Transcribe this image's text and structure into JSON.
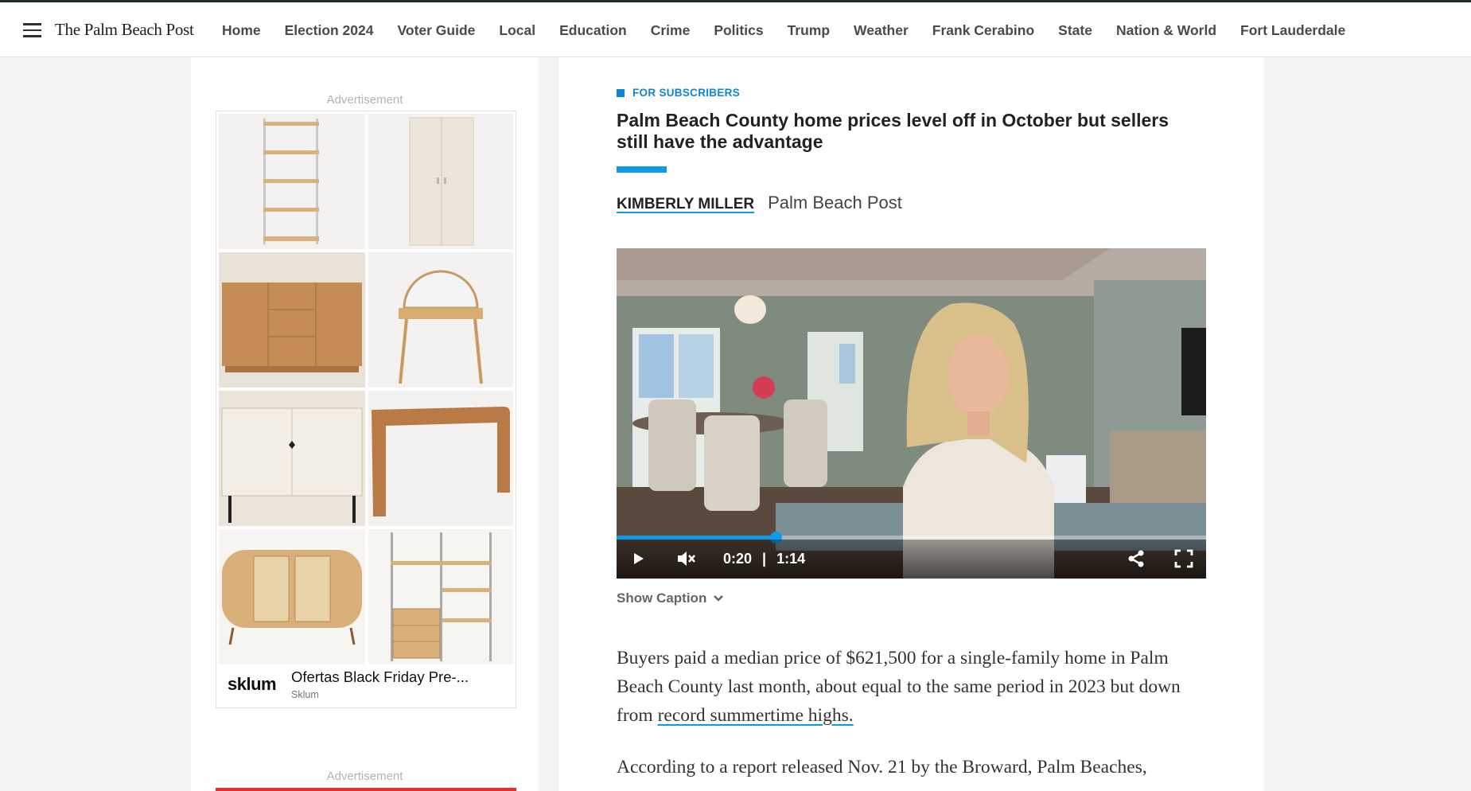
{
  "site": {
    "logo": "The Palm Beach Post"
  },
  "nav": {
    "items": [
      "Home",
      "Election 2024",
      "Voter Guide",
      "Local",
      "Education",
      "Crime",
      "Politics",
      "Trump",
      "Weather",
      "Frank Cerabino",
      "State",
      "Nation & World",
      "Fort Lauderdale"
    ]
  },
  "ads": {
    "label": "Advertisement",
    "first": {
      "brand": "sklum",
      "title": "Ofertas Black Friday Pre-...",
      "advertiser": "Sklum"
    },
    "second_label": "Advertisement"
  },
  "article": {
    "kicker": "FOR SUBSCRIBERS",
    "headline": "Palm Beach County home prices level off in October but sellers still have the advantage",
    "author": "KIMBERLY MILLER",
    "source": "Palm Beach Post",
    "video": {
      "current_time": "0:20",
      "separator": "|",
      "duration": "1:14",
      "progress_fraction": 0.27,
      "show_caption_label": "Show Caption"
    },
    "paragraph1": {
      "text": "Buyers paid a median price of $621,500 for a single-family home in Palm Beach County last month, about equal to the same period in 2023 but down from ",
      "link": "record summertime highs."
    },
    "paragraph2": "According to a report released Nov. 21 by the Broward, Palm Beaches,"
  },
  "colors": {
    "accent": "#0e9ae6",
    "kicker": "#0e86d4"
  }
}
